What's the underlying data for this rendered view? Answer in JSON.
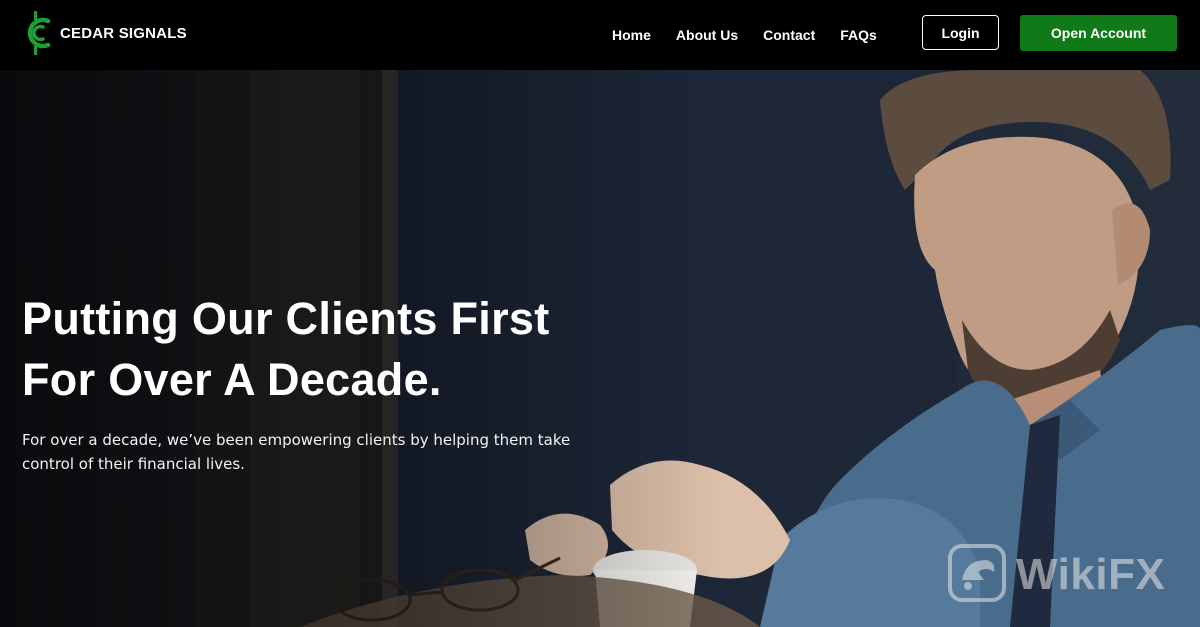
{
  "brand": {
    "name": "CEDAR SIGNALS",
    "logo_icon": "cedar-dollar-c-icon",
    "accent_color": "#1f9e34"
  },
  "nav": {
    "links": [
      {
        "label": "Home"
      },
      {
        "label": "About Us"
      },
      {
        "label": "Contact"
      },
      {
        "label": "FAQs"
      }
    ],
    "login_label": "Login",
    "open_account_label": "Open Account",
    "open_account_color": "#0f7a17"
  },
  "hero": {
    "title_line1": "Putting Our Clients First",
    "title_line2": "For Over A Decade.",
    "subtitle": "For over a decade, we’ve been empowering clients by helping them take control of their financial lives.",
    "image_subject": "man in denim shirt holding a coffee cup beside eyeglasses"
  },
  "watermark": {
    "text": "WikiFX",
    "icon": "wikifx-logo-icon"
  }
}
